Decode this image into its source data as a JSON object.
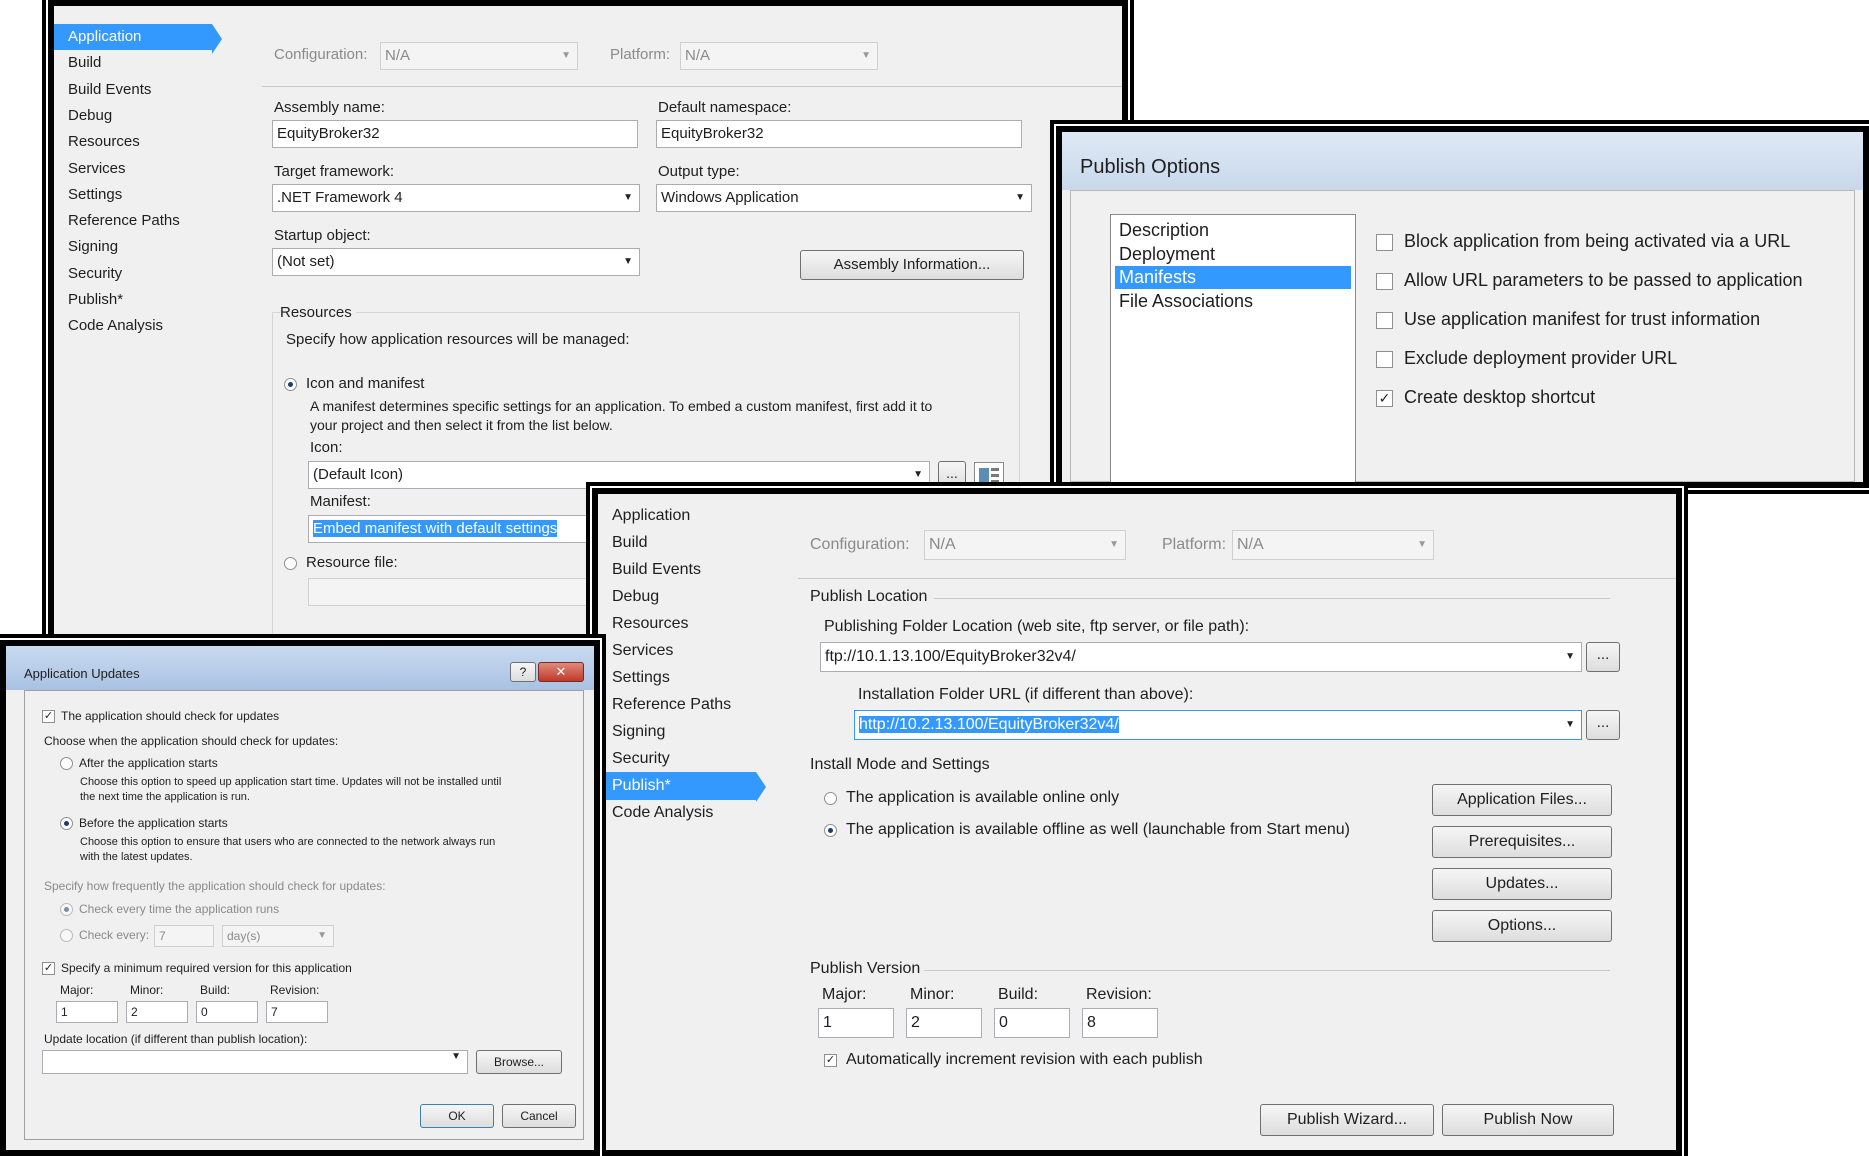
{
  "app_props": {
    "nav": [
      "Application",
      "Build",
      "Build Events",
      "Debug",
      "Resources",
      "Services",
      "Settings",
      "Reference Paths",
      "Signing",
      "Security",
      "Publish*",
      "Code Analysis"
    ],
    "selected_nav": "Application",
    "configuration_label": "Configuration:",
    "configuration_value": "N/A",
    "platform_label": "Platform:",
    "platform_value": "N/A",
    "assembly_name_label": "Assembly name:",
    "assembly_name": "EquityBroker32",
    "default_namespace_label": "Default namespace:",
    "default_namespace": "EquityBroker32",
    "target_framework_label": "Target framework:",
    "target_framework": ".NET Framework 4",
    "output_type_label": "Output type:",
    "output_type": "Windows Application",
    "startup_object_label": "Startup object:",
    "startup_object": "(Not set)",
    "assembly_info_button": "Assembly Information...",
    "resources_group": "Resources",
    "resources_desc": "Specify how application resources will be managed:",
    "icon_manifest_option": "Icon and manifest",
    "icon_manifest_desc1": "A manifest determines specific settings for an application. To embed a custom manifest, first add it to",
    "icon_manifest_desc2": "your project and then select it from the list below.",
    "icon_label": "Icon:",
    "icon_value": "(Default Icon)",
    "browse_button": "...",
    "manifest_label": "Manifest:",
    "manifest_value": "Embed manifest with default settings",
    "resource_file_option": "Resource file:"
  },
  "publish_options": {
    "title": "Publish Options",
    "list": [
      "Description",
      "Deployment",
      "Manifests",
      "File Associations"
    ],
    "selected": "Manifests",
    "options": [
      {
        "label": "Block application from being activated via a URL",
        "checked": false
      },
      {
        "label": "Allow URL parameters to be passed to application",
        "checked": false
      },
      {
        "label": "Use application manifest for trust information",
        "checked": false
      },
      {
        "label": "Exclude deployment provider URL",
        "checked": false
      },
      {
        "label": "Create desktop shortcut",
        "checked": true
      }
    ]
  },
  "publish_props": {
    "nav": [
      "Application",
      "Build",
      "Build Events",
      "Debug",
      "Resources",
      "Services",
      "Settings",
      "Reference Paths",
      "Signing",
      "Security",
      "Publish*",
      "Code Analysis"
    ],
    "selected_nav": "Publish*",
    "configuration_label": "Configuration:",
    "configuration_value": "N/A",
    "platform_label": "Platform:",
    "platform_value": "N/A",
    "publish_location_group": "Publish Location",
    "folder_label": "Publishing Folder Location (web site, ftp server, or file path):",
    "folder_value": "ftp://10.1.13.100/EquityBroker32v4/",
    "install_url_label": "Installation Folder URL (if different than above):",
    "install_url_value": "http://10.2.13.100/EquityBroker32v4/",
    "browse_button": "...",
    "install_mode_group": "Install Mode and Settings",
    "online_only": "The application is available online only",
    "offline": "The application is available offline as well (launchable from Start menu)",
    "app_files_button": "Application Files...",
    "prereq_button": "Prerequisites...",
    "updates_button": "Updates...",
    "options_button": "Options...",
    "version_group": "Publish Version",
    "major_label": "Major:",
    "major": "1",
    "minor_label": "Minor:",
    "minor": "2",
    "build_label": "Build:",
    "build": "0",
    "revision_label": "Revision:",
    "revision": "8",
    "auto_increment": "Automatically increment revision with each publish",
    "auto_increment_checked": true,
    "wizard_button": "Publish Wizard...",
    "publish_now_button": "Publish Now"
  },
  "app_updates": {
    "title": "Application Updates",
    "help_glyph": "?",
    "close_glyph": "✕",
    "check_updates": "The application should check for updates",
    "choose_when": "Choose when the application should check for updates:",
    "after_start": "After the application starts",
    "after_desc1": "Choose this option to speed up application start time. Updates will not be installed until",
    "after_desc2": "the next time the application is run.",
    "before_start": "Before the application starts",
    "before_desc1": "Choose this option to ensure that users who are connected to the network always run",
    "before_desc2": "with the latest updates.",
    "frequency": "Specify how frequently the application should check for updates:",
    "every_run": "Check every time the application runs",
    "check_every": "Check every:",
    "every_value": "7",
    "every_unit": "day(s)",
    "min_version": "Specify a minimum required version for this application",
    "major_label": "Major:",
    "major": "1",
    "minor_label": "Minor:",
    "minor": "2",
    "build_label": "Build:",
    "build": "0",
    "revision_label": "Revision:",
    "revision": "7",
    "update_location": "Update location (if different than publish location):",
    "browse_button": "Browse...",
    "ok_button": "OK",
    "cancel_button": "Cancel"
  }
}
